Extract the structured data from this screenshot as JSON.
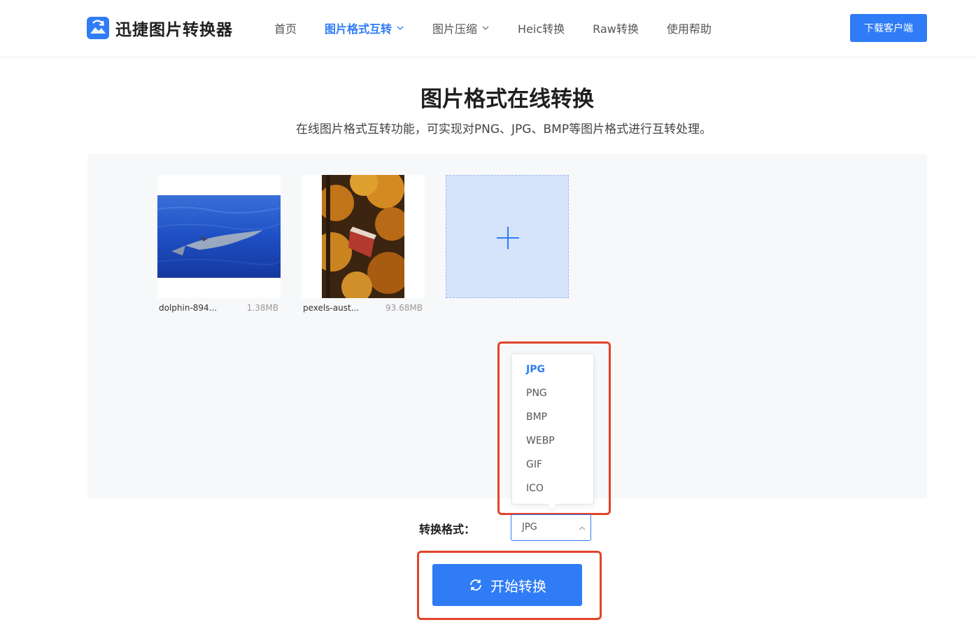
{
  "header": {
    "logo_text": "迅捷图片转换器",
    "nav": [
      {
        "label": "首页",
        "active": false,
        "dropdown": false
      },
      {
        "label": "图片格式互转",
        "active": true,
        "dropdown": true
      },
      {
        "label": "图片压缩",
        "active": false,
        "dropdown": true
      },
      {
        "label": "Heic转换",
        "active": false,
        "dropdown": false
      },
      {
        "label": "Raw转换",
        "active": false,
        "dropdown": false
      },
      {
        "label": "使用帮助",
        "active": false,
        "dropdown": false
      }
    ],
    "download_label": "下载客户端"
  },
  "main": {
    "title": "图片格式在线转换",
    "subtitle": "在线图片格式互转功能，可实现对PNG、JPG、BMP等图片格式进行互转处理。"
  },
  "files": [
    {
      "name": "dolphin-894...",
      "size": "1.38MB",
      "thumb": "dolphin-photo"
    },
    {
      "name": "pexels-aust...",
      "size": "93.68MB",
      "thumb": "autumn-forest-photo"
    }
  ],
  "format": {
    "label": "转换格式：",
    "selected": "JPG",
    "options": [
      "JPG",
      "PNG",
      "BMP",
      "WEBP",
      "GIF",
      "ICO"
    ]
  },
  "start_label": "开始转换",
  "colors": {
    "accent": "#2f7cf6",
    "highlight_box": "#e0442a",
    "panel_bg": "#f7f8fa",
    "add_box_bg": "#d5e4fb"
  }
}
